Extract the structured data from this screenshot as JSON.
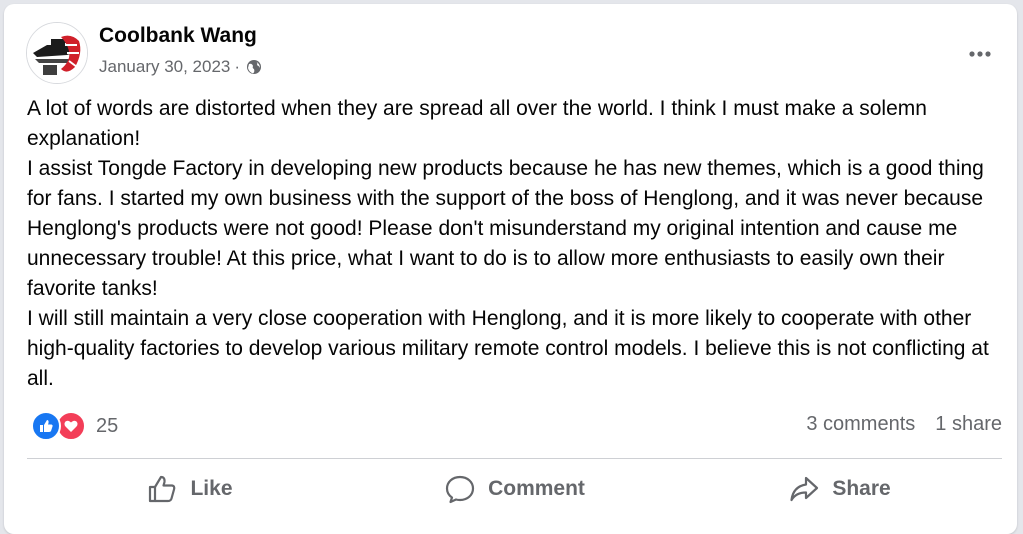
{
  "post": {
    "author": "Coolbank Wang",
    "date": "January 30, 2023",
    "separator": "·",
    "privacy_icon": "globe-icon",
    "more_icon": "more-options-icon",
    "paragraphs": [
      "A lot of words are distorted when they are spread all over the world. I think I must make a solemn explanation!",
      "I assist Tongde Factory in developing new products because he has new themes, which is a good thing for fans. I started my own business with the support of the boss of Henglong, and it was never because Henglong's products were not good! Please don't misunderstand my original intention and cause me unnecessary trouble! At this price, what I want to do is to allow more enthusiasts to easily own their favorite tanks!",
      "I will still maintain a very close cooperation with Henglong, and it is more likely to cooperate with other high-quality factories to develop various military remote control models. I believe this is not conflicting at all."
    ]
  },
  "stats": {
    "reaction_icons": [
      "like-reaction-icon",
      "love-reaction-icon"
    ],
    "reaction_count": "25",
    "comments": "3 comments",
    "shares": "1 share"
  },
  "actions": {
    "like": "Like",
    "comment": "Comment",
    "share": "Share"
  },
  "colors": {
    "like_blue": "#1877f2",
    "love_red": "#f33e58",
    "secondary_text": "#65676b"
  }
}
